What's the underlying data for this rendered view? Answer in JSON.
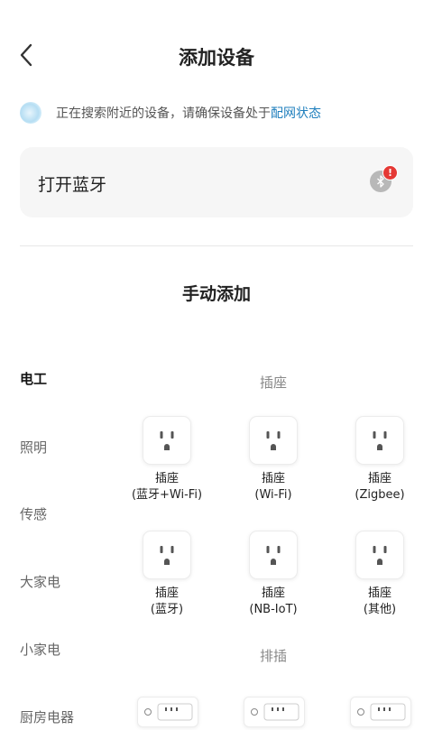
{
  "header": {
    "title": "添加设备",
    "back_icon": "chevron-left-icon"
  },
  "search": {
    "status_text": "正在搜索附近的设备，请确保设备处于",
    "link_text": "配网状态"
  },
  "bluetooth": {
    "label": "打开蓝牙",
    "icon": "bluetooth-icon",
    "badge": "!"
  },
  "manual": {
    "title": "手动添加"
  },
  "sidebar": {
    "items": [
      "电工",
      "照明",
      "传感",
      "大家电",
      "小家电",
      "厨房电器"
    ],
    "active_index": 0
  },
  "sections": [
    {
      "title": "插座",
      "devices": [
        {
          "line1": "插座",
          "line2": "(蓝牙+Wi-Fi)"
        },
        {
          "line1": "插座",
          "line2": "(Wi-Fi)"
        },
        {
          "line1": "插座",
          "line2": "(Zigbee)"
        },
        {
          "line1": "插座",
          "line2": "(蓝牙)"
        },
        {
          "line1": "插座",
          "line2": "(NB-IoT)"
        },
        {
          "line1": "插座",
          "line2": "(其他)"
        }
      ]
    },
    {
      "title": "排插"
    }
  ],
  "colors": {
    "accent_link": "#1f7fbd",
    "badge_red": "#e53935",
    "card_bg": "#f6f6f6"
  }
}
